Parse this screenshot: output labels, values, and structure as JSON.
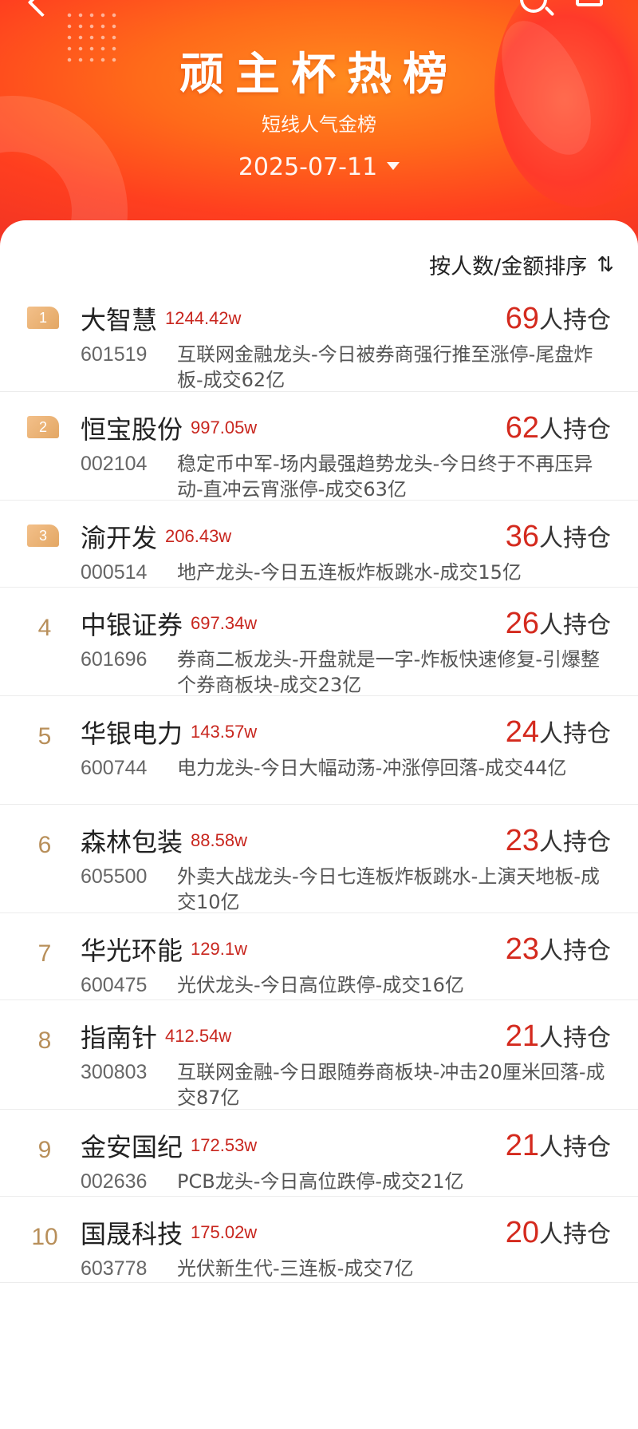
{
  "header": {
    "title": "顽主杯热榜",
    "subtitle": "短线人气金榜",
    "date": "2025-07-11"
  },
  "sort": {
    "label": "按人数/金额排序",
    "icon": "⇅"
  },
  "colors": {
    "accent": "#d42a1e",
    "amount": "#c8261e",
    "rank": "#b88f5a",
    "header": "#ff5a1e"
  },
  "holders_suffix": "人持仓",
  "rows": [
    {
      "rank": "1",
      "name": "大智慧",
      "amount": "1244.42w",
      "code": "601519",
      "desc": "互联网金融龙头-今日被券商强行推至涨停-尾盘炸板-成交62亿",
      "holders": "69"
    },
    {
      "rank": "2",
      "name": "恒宝股份",
      "amount": "997.05w",
      "code": "002104",
      "desc": "稳定币中军-场内最强趋势龙头-今日终于不再压异动-直冲云宵涨停-成交63亿",
      "holders": "62"
    },
    {
      "rank": "3",
      "name": "渝开发",
      "amount": "206.43w",
      "code": "000514",
      "desc": "地产龙头-今日五连板炸板跳水-成交15亿",
      "holders": "36"
    },
    {
      "rank": "4",
      "name": "中银证券",
      "amount": "697.34w",
      "code": "601696",
      "desc": "券商二板龙头-开盘就是一字-炸板快速修复-引爆整个券商板块-成交23亿",
      "holders": "26"
    },
    {
      "rank": "5",
      "name": "华银电力",
      "amount": "143.57w",
      "code": "600744",
      "desc": "电力龙头-今日大幅动荡-冲涨停回落-成交44亿",
      "holders": "24"
    },
    {
      "rank": "6",
      "name": "森林包装",
      "amount": "88.58w",
      "code": "605500",
      "desc": "外卖大战龙头-今日七连板炸板跳水-上演天地板-成交10亿",
      "holders": "23"
    },
    {
      "rank": "7",
      "name": "华光环能",
      "amount": "129.1w",
      "code": "600475",
      "desc": "光伏龙头-今日高位跌停-成交16亿",
      "holders": "23"
    },
    {
      "rank": "8",
      "name": "指南针",
      "amount": "412.54w",
      "code": "300803",
      "desc": "互联网金融-今日跟随券商板块-冲击20厘米回落-成交87亿",
      "holders": "21"
    },
    {
      "rank": "9",
      "name": "金安国纪",
      "amount": "172.53w",
      "code": "002636",
      "desc": "PCB龙头-今日高位跌停-成交21亿",
      "holders": "21"
    },
    {
      "rank": "10",
      "name": "国晟科技",
      "amount": "175.02w",
      "code": "603778",
      "desc": "光伏新生代-三连板-成交7亿",
      "holders": "20"
    }
  ]
}
